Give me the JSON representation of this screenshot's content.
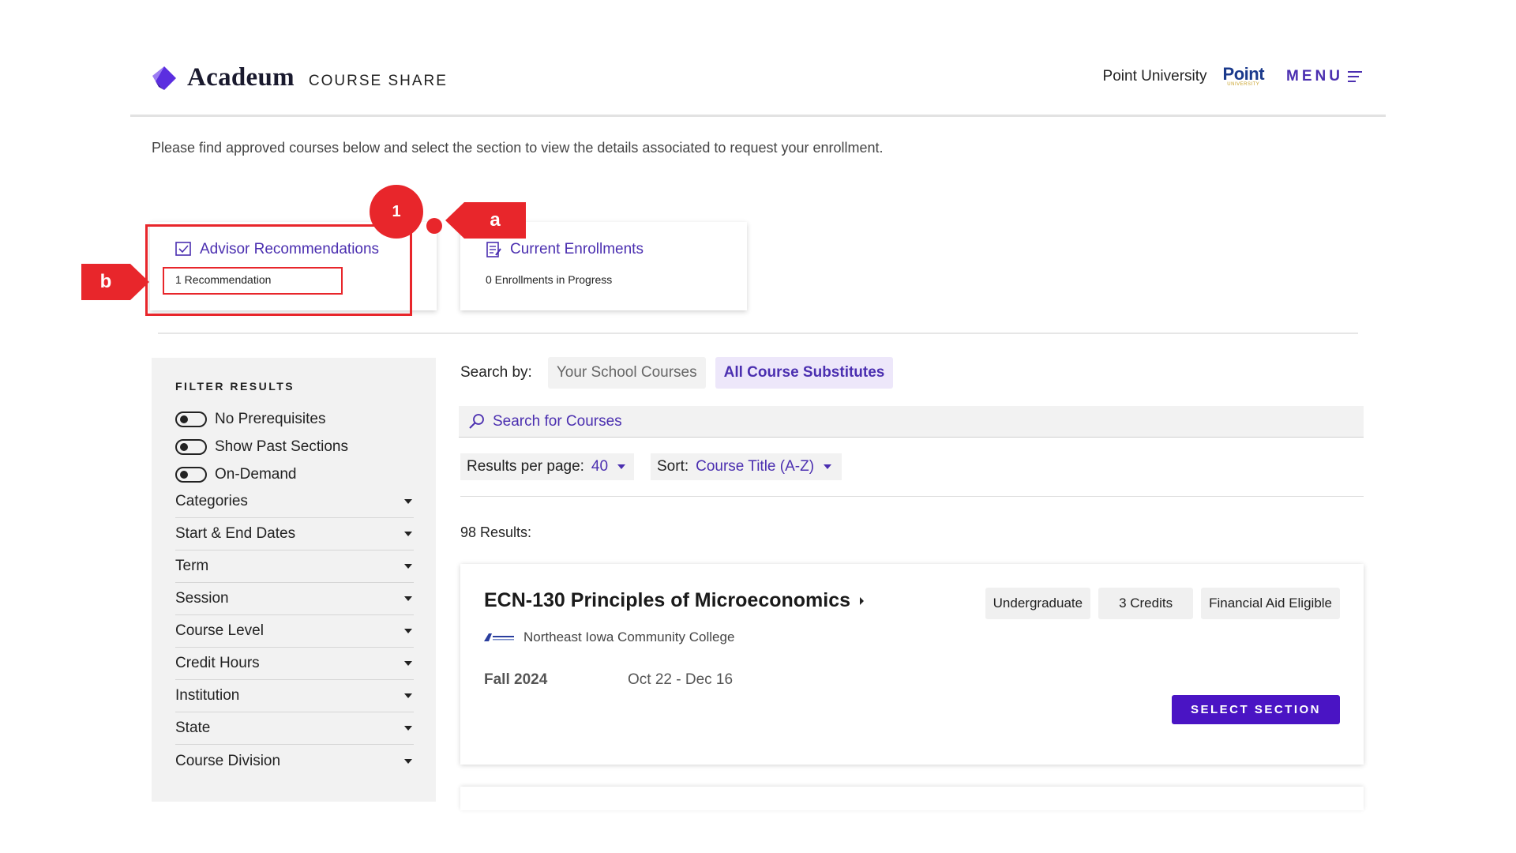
{
  "header": {
    "logo_text": "Acadeum",
    "logo_sub": "COURSE SHARE",
    "university_name": "Point University",
    "university_logo_main": "Point",
    "university_logo_sub": "UNIVERSITY",
    "menu_label": "MENU"
  },
  "intro_text": "Please find approved courses below and select the section to view the details associated to request your enrollment.",
  "cards": {
    "advisor": {
      "title": "Advisor Recommendations",
      "subtitle": "1 Recommendation"
    },
    "enrollments": {
      "title": "Current Enrollments",
      "subtitle": "0 Enrollments in Progress"
    }
  },
  "annotations": {
    "circle": "1",
    "tag_a": "a",
    "tag_b": "b"
  },
  "filters": {
    "title": "FILTER RESULTS",
    "toggles": [
      "No Prerequisites",
      "Show Past Sections",
      "On-Demand"
    ],
    "dropdowns": [
      "Categories",
      "Start & End Dates",
      "Term",
      "Session",
      "Course Level",
      "Credit Hours",
      "Institution",
      "State",
      "Course Division"
    ]
  },
  "search": {
    "label": "Search by:",
    "option_school": "Your School Courses",
    "option_substitutes": "All Course Substitutes",
    "placeholder": "Search for Courses"
  },
  "controls": {
    "results_per_page_label": "Results per page:",
    "results_per_page_value": "40",
    "sort_label": "Sort:",
    "sort_value": "Course Title (A-Z)"
  },
  "results_count": "98 Results:",
  "course": {
    "title": "ECN-130 Principles of Microeconomics",
    "tags": [
      "Undergraduate",
      "3 Credits",
      "Financial Aid Eligible"
    ],
    "institution": "Northeast Iowa Community College",
    "term": "Fall 2024",
    "dates": "Oct 22 - Dec 16",
    "select_label": "SELECT SECTION"
  },
  "colors": {
    "accent": "#4b2fb0",
    "button": "#4a14c4",
    "annotation": "#e8262b"
  }
}
